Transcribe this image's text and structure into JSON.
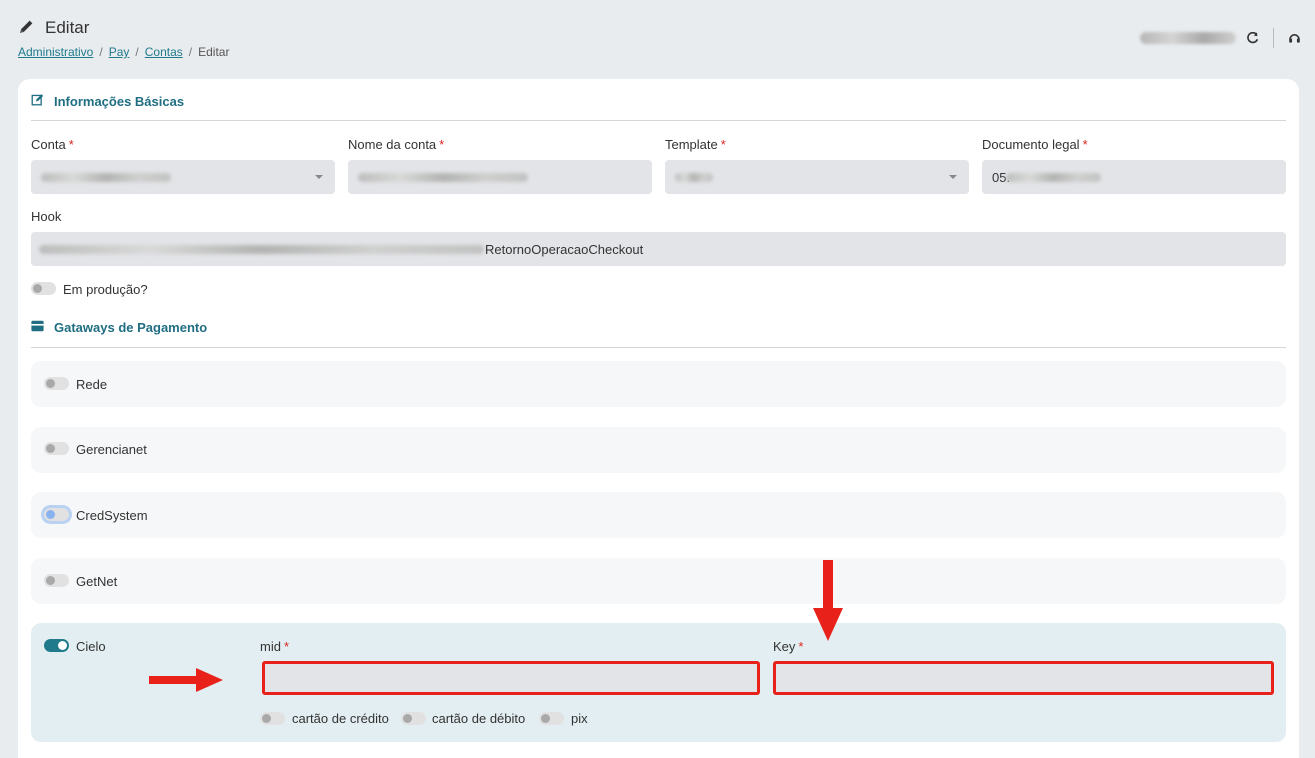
{
  "header": {
    "title": "Editar",
    "breadcrumb": [
      {
        "label": "Administrativo"
      },
      {
        "label": "Pay"
      },
      {
        "label": "Contas"
      },
      {
        "label": "Editar"
      }
    ],
    "separator": "/"
  },
  "basic": {
    "section_title": "Informações Básicas",
    "conta_label": "Conta",
    "nome_label": "Nome da conta",
    "template_label": "Template",
    "documento_label": "Documento legal",
    "documento_prefix": "05.",
    "hook_label": "Hook",
    "hook_suffix": "RetornoOperacaoCheckout",
    "producao_label": "Em produção?",
    "required_mark": "*"
  },
  "gateways": {
    "section_title": "Gataways de Pagamento",
    "items": [
      {
        "label": "Rede",
        "enabled": false
      },
      {
        "label": "Gerencianet",
        "enabled": false
      },
      {
        "label": "CredSystem",
        "enabled": false
      },
      {
        "label": "GetNet",
        "enabled": false
      },
      {
        "label": "Cielo",
        "enabled": true
      }
    ]
  },
  "cielo": {
    "mid_label": "mid",
    "key_label": "Key",
    "mid_value": "",
    "key_value": "",
    "options": [
      {
        "label": "cartão de crédito",
        "enabled": false
      },
      {
        "label": "cartão de débito",
        "enabled": false
      },
      {
        "label": "pix",
        "enabled": false
      }
    ]
  },
  "colors": {
    "accent": "#1f7a8c",
    "required": "#d9251e",
    "annotation": "#e8211a"
  }
}
